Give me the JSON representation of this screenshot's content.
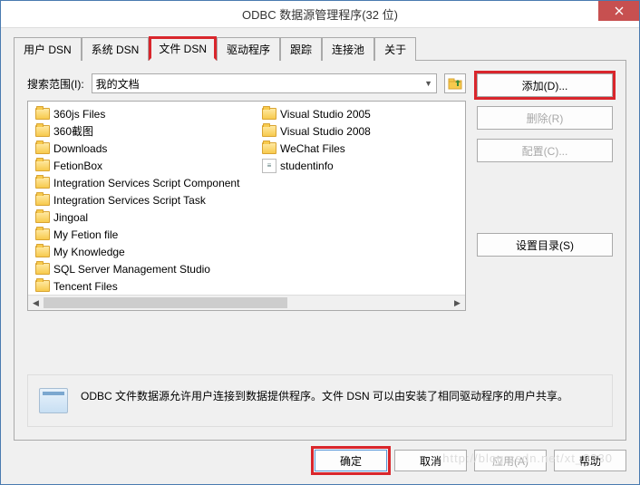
{
  "title": "ODBC 数据源管理程序(32 位)",
  "tabs": [
    "用户 DSN",
    "系统 DSN",
    "文件 DSN",
    "驱动程序",
    "跟踪",
    "连接池",
    "关于"
  ],
  "active_tab": 2,
  "search": {
    "label": "搜索范围(I):",
    "value": "我的文档"
  },
  "files_col1": [
    {
      "name": "360js Files",
      "type": "folder"
    },
    {
      "name": "360截图",
      "type": "folder"
    },
    {
      "name": "Downloads",
      "type": "folder"
    },
    {
      "name": "FetionBox",
      "type": "folder"
    },
    {
      "name": "Integration Services Script Component",
      "type": "folder"
    },
    {
      "name": "Integration Services Script Task",
      "type": "folder"
    },
    {
      "name": "Jingoal",
      "type": "folder"
    },
    {
      "name": "My Fetion file",
      "type": "folder"
    },
    {
      "name": "My Knowledge",
      "type": "folder"
    },
    {
      "name": "SQL Server Management Studio",
      "type": "folder"
    },
    {
      "name": "Tencent Files",
      "type": "folder"
    }
  ],
  "files_col2": [
    {
      "name": "Visual Studio 2005",
      "type": "folder"
    },
    {
      "name": "Visual Studio 2008",
      "type": "folder"
    },
    {
      "name": "WeChat Files",
      "type": "folder"
    },
    {
      "name": "studentinfo",
      "type": "dsn"
    }
  ],
  "side_buttons": {
    "add": "添加(D)...",
    "remove": "删除(R)",
    "config": "配置(C)...",
    "setdir": "设置目录(S)"
  },
  "info": "ODBC 文件数据源允许用户连接到数据提供程序。文件 DSN 可以由安装了相同驱动程序的用户共享。",
  "buttons": {
    "ok": "确定",
    "cancel": "取消",
    "apply": "应用(A)",
    "help": "帮助"
  },
  "watermark": "http://blog.csdn.net/xt_0330"
}
